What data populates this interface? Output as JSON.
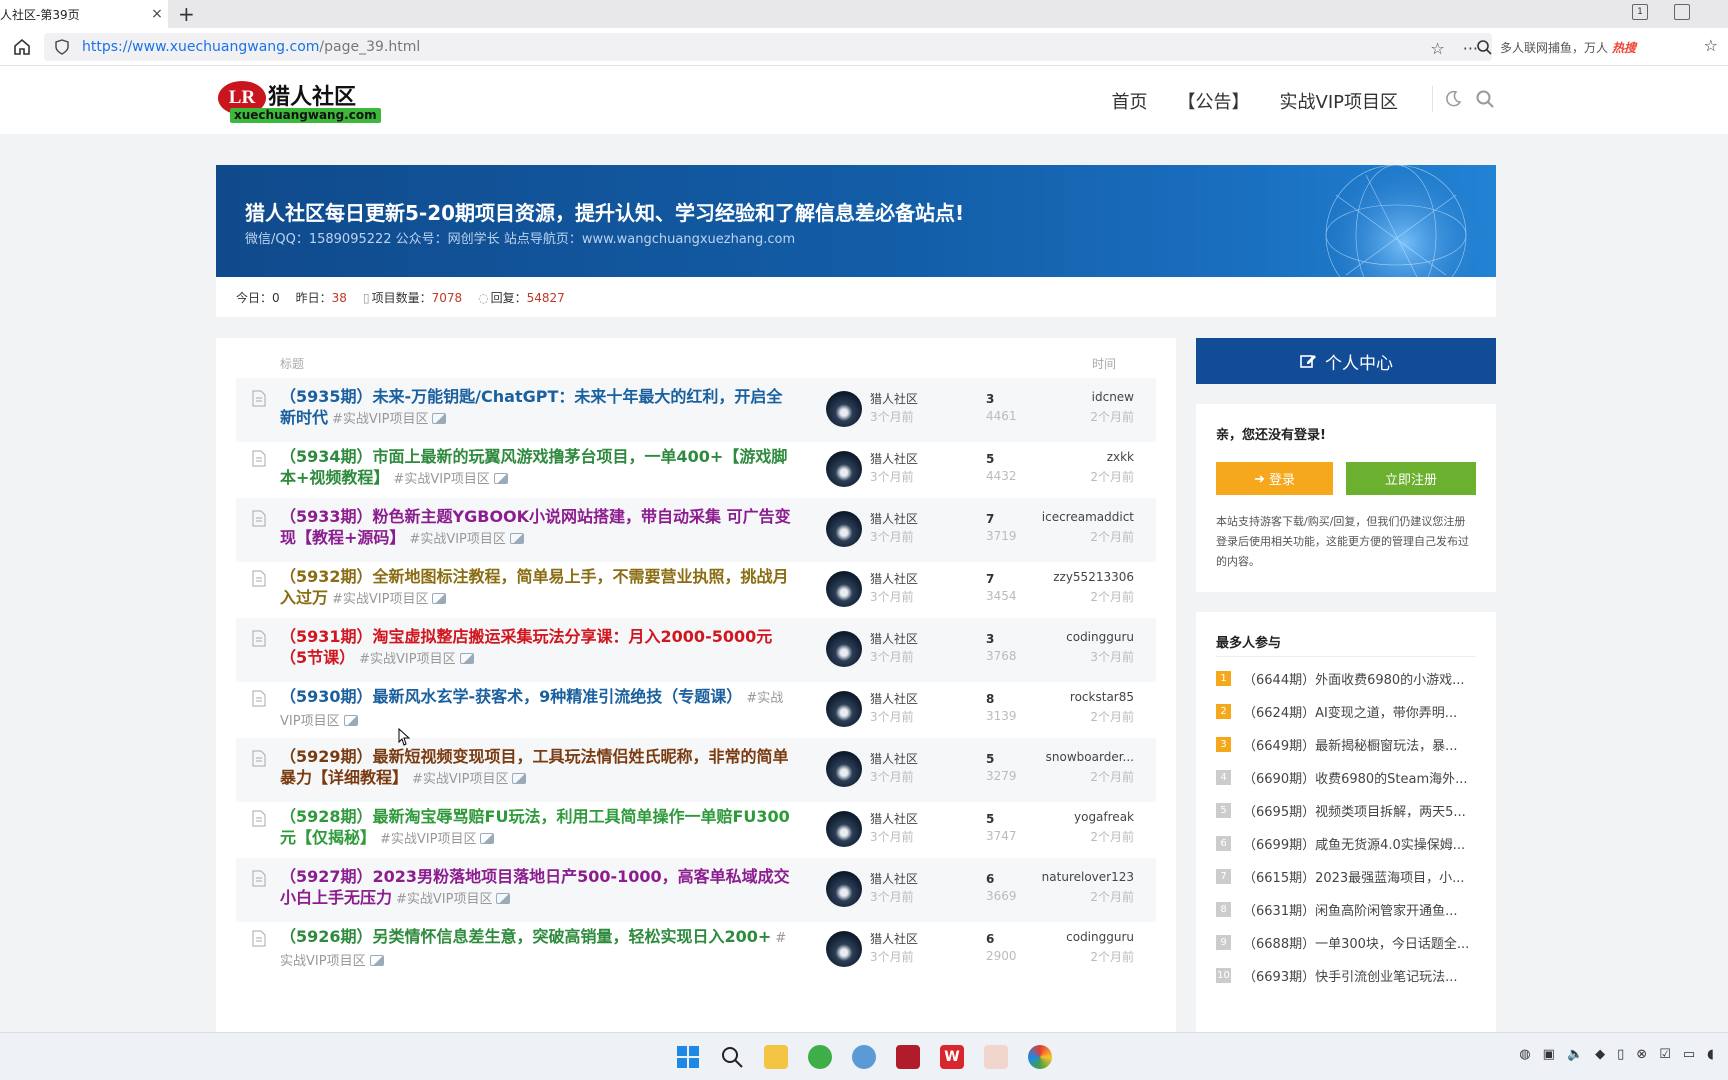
{
  "browser": {
    "tab_title": "人社区-第39页",
    "tab_close": "×",
    "new_tab": "+",
    "url_domain": "https://www.xuechuangwang.com",
    "url_path": "/page_39.html",
    "search_text": "多人联网捕鱼，万人",
    "search_hot": "热搜",
    "window_badge": "1"
  },
  "site": {
    "logo_mark": "LR",
    "logo_name": "猎人社区",
    "logo_domain": "xuechuangwang.com",
    "nav": [
      "首页",
      "【公告】",
      "实战VIP项目区"
    ]
  },
  "banner": {
    "title": "猎人社区每日更新5-20期项目资源，提升认知、学习经验和了解信息差必备站点!",
    "subtitle": "微信/QQ：1589095222 公众号：网创学长 站点导航页：www.wangchuangxuezhang.com"
  },
  "stats": {
    "today_label": "今日：",
    "today_value": "0",
    "yesterday_label": "昨日：",
    "yesterday_value": "38",
    "projects_label": "项目数量：",
    "projects_value": "7078",
    "replies_label": "回复：",
    "replies_value": "54827"
  },
  "list": {
    "header_title": "标题",
    "header_time": "时间",
    "rows": [
      {
        "title": "（5935期）未来-万能钥匙/ChatGPT：未来十年最大的红利，开启全新时代",
        "tag": "#实战VIP项目区",
        "color": "#1a5f9e",
        "author": "猎人社区",
        "author_time": "3个月前",
        "replies": "3",
        "views": "4461",
        "last_user": "idcnew",
        "last_time": "2个月前"
      },
      {
        "title": "（5934期）市面上最新的玩翼风游戏撸茅台项目，一单400+【游戏脚本+视频教程】",
        "tag": "#实战VIP项目区",
        "color": "#2e8b3d",
        "author": "猎人社区",
        "author_time": "3个月前",
        "replies": "5",
        "views": "4432",
        "last_user": "zxkk",
        "last_time": "2个月前"
      },
      {
        "title": "（5933期）粉色新主题YGBOOK小说网站搭建，带自动采集 可广告变现【教程+源码】",
        "tag": "#实战VIP项目区",
        "color": "#8b1d8f",
        "author": "猎人社区",
        "author_time": "3个月前",
        "replies": "7",
        "views": "3719",
        "last_user": "icecreamaddict",
        "last_time": "2个月前"
      },
      {
        "title": "（5932期）全新地图标注教程，简单易上手，不需要营业执照，挑战月入过万",
        "tag": "#实战VIP项目区",
        "color": "#8a6d12",
        "author": "猎人社区",
        "author_time": "3个月前",
        "replies": "7",
        "views": "3454",
        "last_user": "zzy55213306",
        "last_time": "2个月前"
      },
      {
        "title": "（5931期）淘宝虚拟整店搬运采集玩法分享课：月入2000-5000元（5节课）",
        "tag": "#实战VIP项目区",
        "color": "#d0161e",
        "author": "猎人社区",
        "author_time": "3个月前",
        "replies": "3",
        "views": "3768",
        "last_user": "codingguru",
        "last_time": "3个月前"
      },
      {
        "title": "（5930期）最新风水玄学-获客术，9种精准引流绝技（专题课）",
        "tag": "#实战VIP项目区",
        "color": "#1a5f9e",
        "author": "猎人社区",
        "author_time": "3个月前",
        "replies": "8",
        "views": "3139",
        "last_user": "rockstar85",
        "last_time": "2个月前"
      },
      {
        "title": "（5929期）最新短视频变现项目，工具玩法情侣姓氏昵称，非常的简单暴力【详细教程】",
        "tag": "#实战VIP项目区",
        "color": "#7a3b10",
        "author": "猎人社区",
        "author_time": "3个月前",
        "replies": "5",
        "views": "3279",
        "last_user": "snowboarder...",
        "last_time": "2个月前"
      },
      {
        "title": "（5928期）最新淘宝辱骂赔FU玩法，利用工具简单操作一单赔FU300元【仅揭秘】",
        "tag": "#实战VIP项目区",
        "color": "#2e9a3a",
        "author": "猎人社区",
        "author_time": "3个月前",
        "replies": "5",
        "views": "3747",
        "last_user": "yogafreak",
        "last_time": "2个月前"
      },
      {
        "title": "（5927期）2023男粉落地项目落地日产500-1000，高客单私域成交 小白上手无压力",
        "tag": "#实战VIP项目区",
        "color": "#8b1d8f",
        "author": "猎人社区",
        "author_time": "3个月前",
        "replies": "6",
        "views": "3669",
        "last_user": "naturelover123",
        "last_time": "2个月前"
      },
      {
        "title": "（5926期）另类情怀信息差生意，突破高销量，轻松实现日入200+",
        "tag": "#实战VIP项目区",
        "color": "#2e8b3d",
        "author": "猎人社区",
        "author_time": "3个月前",
        "replies": "6",
        "views": "2900",
        "last_user": "codingguru",
        "last_time": "2个月前"
      }
    ]
  },
  "sidebar": {
    "ucenter_label": "个人中心",
    "hello": "亲，您还没有登录!",
    "login_label": "登录",
    "register_label": "立即注册",
    "note": "本站支持游客下载/购买/回复，但我们仍建议您注册登录后使用相关功能，这能更方便的管理自己发布过的内容。",
    "hot_title": "最多人参与",
    "hot_items": [
      {
        "rank": "1",
        "text": "（6644期）外面收费6980的小游戏..."
      },
      {
        "rank": "2",
        "text": "（6624期）AI变现之道，带你弄明..."
      },
      {
        "rank": "3",
        "text": "（6649期）最新揭秘橱窗玩法，暴..."
      },
      {
        "rank": "4",
        "text": "（6690期）收费6980的Steam海外..."
      },
      {
        "rank": "5",
        "text": "（6695期）视频类项目拆解，两天5..."
      },
      {
        "rank": "6",
        "text": "（6699期）咸鱼无货源4.0实操保姆..."
      },
      {
        "rank": "7",
        "text": "（6615期）2023最强蓝海项目，小..."
      },
      {
        "rank": "8",
        "text": "（6631期）闲鱼高阶闲管家开通鱼..."
      },
      {
        "rank": "9",
        "text": "（6688期）一单300块，今日话题全..."
      },
      {
        "rank": "10",
        "text": "（6693期）快手引流创业笔记玩法..."
      }
    ]
  },
  "colors": {
    "brand_blue": "#124c96",
    "login_orange": "#f5a81c",
    "register_green": "#6bb12f",
    "stat_red": "#c0392b"
  }
}
